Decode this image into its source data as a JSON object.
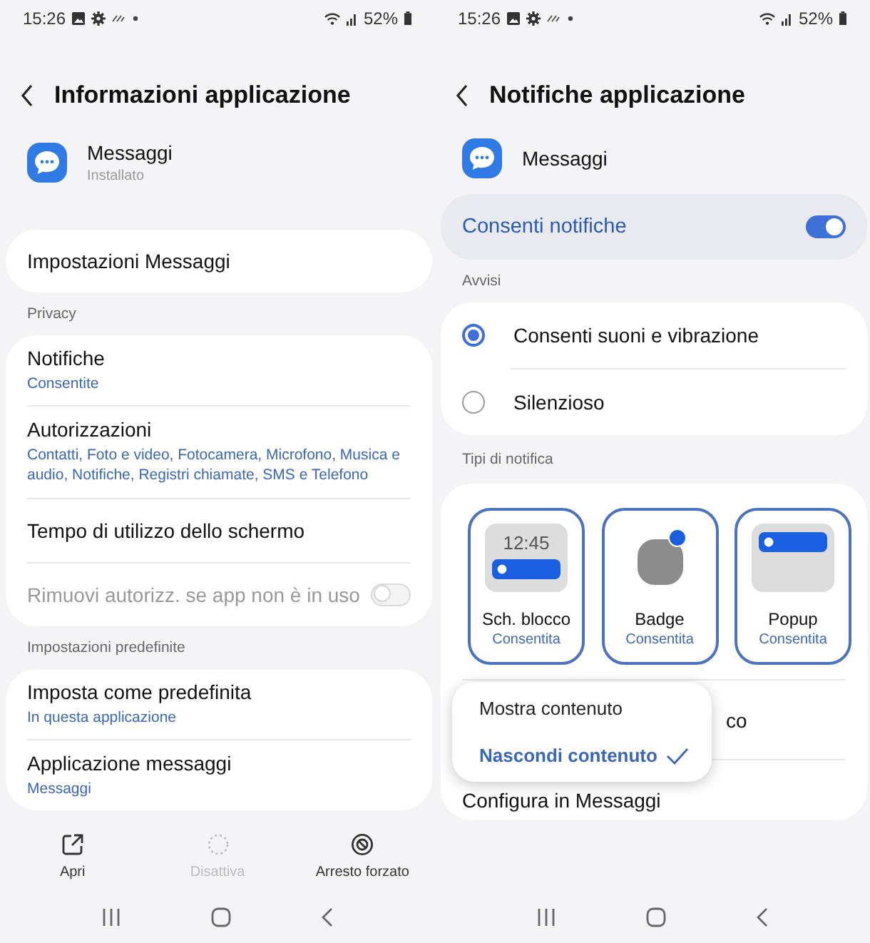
{
  "left": {
    "status": {
      "time": "15:26",
      "battery": "52%"
    },
    "title": "Informazioni applicazione",
    "app": {
      "name": "Messaggi",
      "status": "Installato"
    },
    "groups": [
      {
        "items": [
          {
            "kind": "link",
            "title": "Impostazioni Messaggi"
          }
        ]
      },
      {
        "label": "Privacy",
        "items": [
          {
            "kind": "sub",
            "title": "Notifiche",
            "subtitle": "Consentite"
          },
          {
            "kind": "sub",
            "title": "Autorizzazioni",
            "subtitle": "Contatti, Foto e video, Fotocamera, Microfono, Musica e audio, Notifiche, Registri chiamate, SMS e Telefono"
          },
          {
            "kind": "link",
            "title": "Tempo di utilizzo dello schermo"
          },
          {
            "kind": "toggle",
            "title": "Rimuovi autorizz. se app non è in uso",
            "on": false,
            "disabled": true
          }
        ]
      },
      {
        "label": "Impostazioni predefinite",
        "items": [
          {
            "kind": "sub",
            "title": "Imposta come predefinita",
            "subtitle": "In questa applicazione"
          },
          {
            "kind": "sub",
            "title": "Applicazione messaggi",
            "subtitle": "Messaggi"
          }
        ]
      }
    ],
    "actions": [
      {
        "kind": "open",
        "label": "Apri",
        "disabled": false
      },
      {
        "kind": "disable",
        "label": "Disattiva",
        "disabled": true
      },
      {
        "kind": "stop",
        "label": "Arresto forzato",
        "disabled": false
      }
    ]
  },
  "right": {
    "status": {
      "time": "15:26",
      "battery": "52%"
    },
    "title": "Notifiche applicazione",
    "app": {
      "name": "Messaggi"
    },
    "master": {
      "label": "Consenti notifiche",
      "on": true
    },
    "alerts_label": "Avvisi",
    "alerts": [
      {
        "label": "Consenti suoni e vibrazione",
        "selected": true
      },
      {
        "label": "Silenzioso",
        "selected": false
      }
    ],
    "types_label": "Tipi di notifica",
    "tiles": [
      {
        "kind": "lock",
        "time": "12:45",
        "label": "Sch. blocco",
        "status": "Consentita",
        "selected": true
      },
      {
        "kind": "badge",
        "label": "Badge",
        "status": "Consentita",
        "selected": true
      },
      {
        "kind": "popup",
        "label": "Popup",
        "status": "Consentita",
        "selected": true
      }
    ],
    "rows": [
      {
        "title": "co"
      },
      {
        "title": "Configura in Messaggi"
      }
    ],
    "menu": [
      {
        "label": "Mostra contenuto",
        "selected": false
      },
      {
        "label": "Nascondi contenuto",
        "selected": true
      }
    ]
  }
}
